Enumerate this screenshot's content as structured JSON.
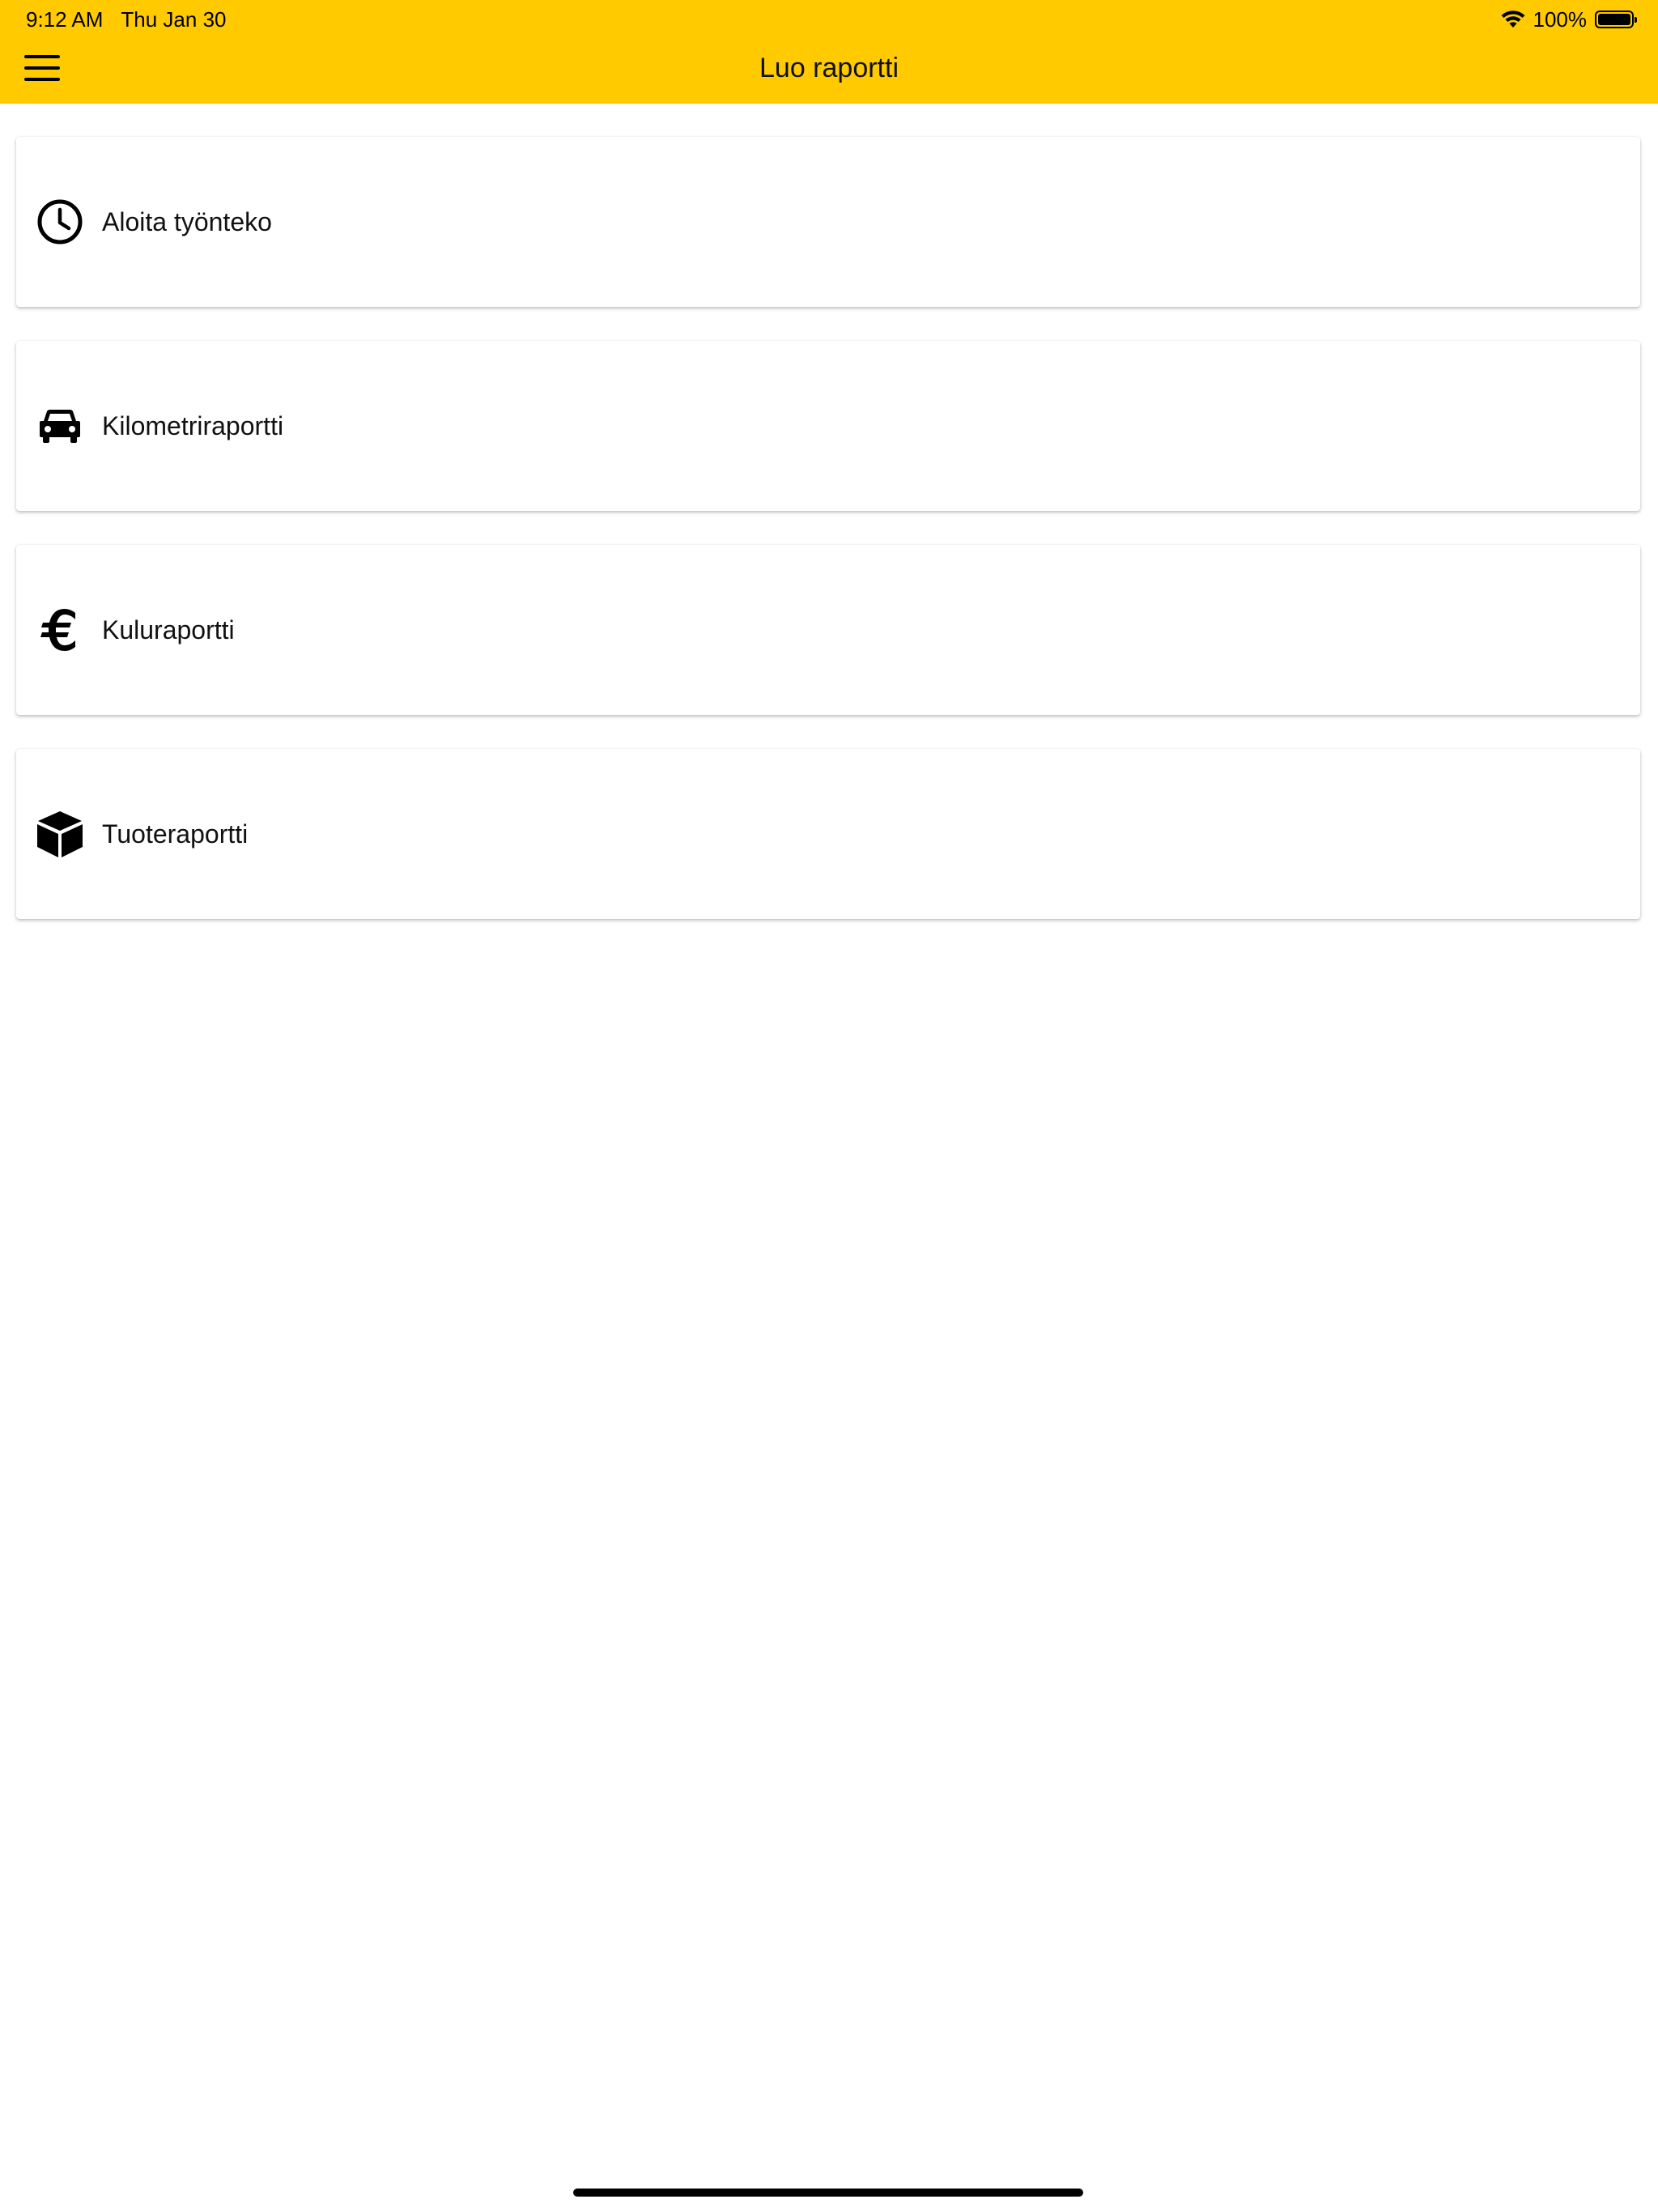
{
  "status_bar": {
    "time": "9:12 AM",
    "date": "Thu Jan 30",
    "battery": "100%",
    "battery_level": 1.0
  },
  "header": {
    "title": "Luo raportti",
    "menu_icon": "hamburger-menu-icon",
    "background_color": "#FFCA00"
  },
  "menu": {
    "items": [
      {
        "label": "Aloita työnteko",
        "icon": "clock-icon"
      },
      {
        "label": "Kilometriraportti",
        "icon": "car-icon"
      },
      {
        "label": "Kuluraportti",
        "icon": "euro-icon"
      },
      {
        "label": "Tuoteraportti",
        "icon": "box-icon"
      }
    ]
  }
}
